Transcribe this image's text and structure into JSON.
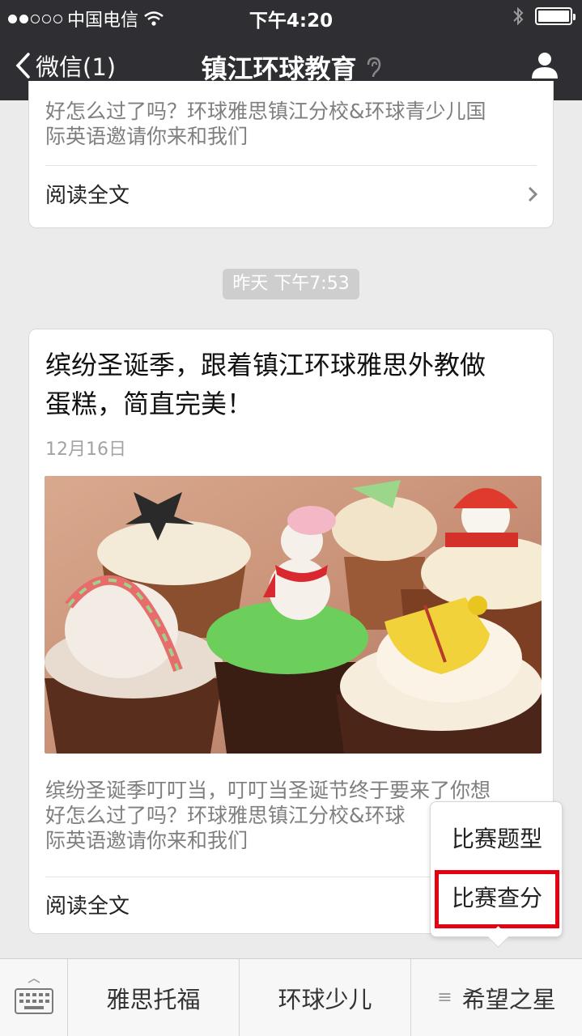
{
  "status": {
    "carrier": "中国电信",
    "time": "下午4:20"
  },
  "nav": {
    "back_label": "微信(1)",
    "title": "镇江环球教育"
  },
  "card_top": {
    "excerpt_line1": "好怎么过了吗？环球雅思镇江分校&环球青少儿国",
    "excerpt_line2": "际英语邀请你来和我们",
    "read_more": "阅读全文"
  },
  "timestamp": "昨天 下午7:53",
  "article": {
    "title_line1": "缤纷圣诞季，跟着镇江环球雅思外教做",
    "title_line2": "蛋糕，简直完美！",
    "date": "12月16日",
    "excerpt_line1": "缤纷圣诞季叮叮当，叮叮当圣诞节终于要来了你想",
    "excerpt_line2": "好怎么过了吗？环球雅思镇江分校&环球",
    "excerpt_line3": "际英语邀请你来和我们",
    "read_more": "阅读全文"
  },
  "popup": {
    "item1": "比赛题型",
    "item2": "比赛查分"
  },
  "bottom_menu": {
    "btn1": "雅思托福",
    "btn2": "环球少儿",
    "btn3": "希望之星"
  },
  "colors": {
    "nav_bg": "#2e2e33",
    "highlight_red": "#e50012"
  }
}
